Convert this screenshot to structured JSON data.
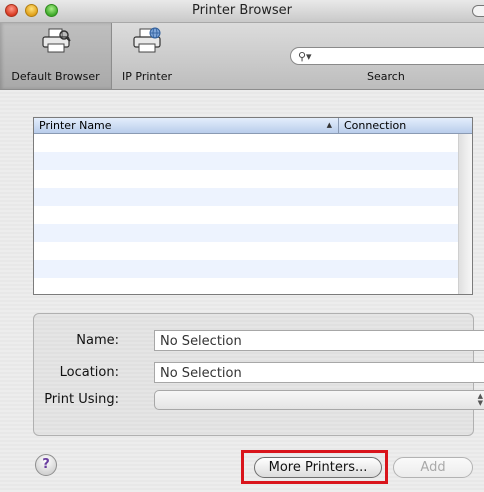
{
  "window": {
    "title": "Printer Browser"
  },
  "toolbar": {
    "items": [
      {
        "label": "Default Browser",
        "icon": "printer-icon",
        "selected": true
      },
      {
        "label": "IP Printer",
        "icon": "ip-printer-icon",
        "selected": false
      }
    ],
    "search": {
      "label": "Search",
      "value": "",
      "icon": "magnifier-icon"
    }
  },
  "table": {
    "columns": [
      "Printer Name",
      "Connection"
    ],
    "sort_column": "Printer Name",
    "sort_direction": "ascending",
    "rows": []
  },
  "info": {
    "name_label": "Name:",
    "name_value": "No Selection",
    "location_label": "Location:",
    "location_value": "No Selection",
    "print_using_label": "Print Using:",
    "print_using_value": ""
  },
  "buttons": {
    "help": "?",
    "more_printers": "More Printers...",
    "add": "Add"
  },
  "colors": {
    "highlight": "#d9141b",
    "row_stripe": "#edf3fe",
    "header": "#b9cdeb"
  }
}
